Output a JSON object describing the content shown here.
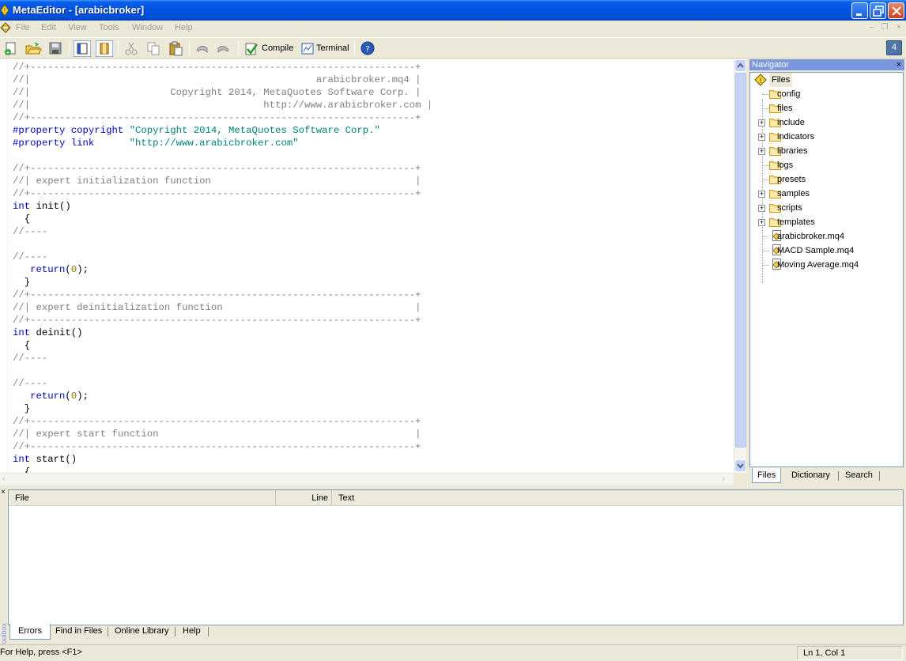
{
  "window": {
    "title": "MetaEditor - [arabicbroker]",
    "icons": {
      "app": "metaeditor-icon",
      "minimize": "minimize-icon",
      "restore": "restore-icon",
      "close": "close-icon"
    }
  },
  "menu": {
    "items": [
      "File",
      "Edit",
      "View",
      "Tools",
      "Window",
      "Help"
    ]
  },
  "toolbar": {
    "compile_label": "Compile",
    "terminal_label": "Terminal",
    "count_badge": "4"
  },
  "editor": {
    "lines": [
      [
        [
          "c-comment",
          "//+------------------------------------------------------------------+"
        ]
      ],
      [
        [
          "c-comment",
          "//|                                                 arabicbroker.mq4 |"
        ]
      ],
      [
        [
          "c-comment",
          "//|                        Copyright 2014, MetaQuotes Software Corp. |"
        ]
      ],
      [
        [
          "c-comment",
          "//|                                        http://www.arabicbroker.com |"
        ]
      ],
      [
        [
          "c-comment",
          "//+------------------------------------------------------------------+"
        ]
      ],
      [
        [
          "c-kw",
          "#property copyright "
        ],
        [
          "c-str",
          "\"Copyright 2014, MetaQuotes Software Corp.\""
        ]
      ],
      [
        [
          "c-kw",
          "#property link      "
        ],
        [
          "c-str",
          "\"http://www.arabicbroker.com\""
        ]
      ],
      [
        [
          "c-plain",
          ""
        ]
      ],
      [
        [
          "c-comment",
          "//+------------------------------------------------------------------+"
        ]
      ],
      [
        [
          "c-comment",
          "//| expert initialization function                                   |"
        ]
      ],
      [
        [
          "c-comment",
          "//+------------------------------------------------------------------+"
        ]
      ],
      [
        [
          "c-kw",
          "int"
        ],
        [
          "c-plain",
          " init()"
        ]
      ],
      [
        [
          "c-plain",
          "  {"
        ]
      ],
      [
        [
          "c-comment",
          "//----"
        ]
      ],
      [
        [
          "c-plain",
          ""
        ]
      ],
      [
        [
          "c-comment",
          "//----"
        ]
      ],
      [
        [
          "c-plain",
          "   "
        ],
        [
          "c-kw",
          "return"
        ],
        [
          "c-plain",
          "("
        ],
        [
          "c-num",
          "0"
        ],
        [
          "c-plain",
          ");"
        ]
      ],
      [
        [
          "c-plain",
          "  }"
        ]
      ],
      [
        [
          "c-comment",
          "//+------------------------------------------------------------------+"
        ]
      ],
      [
        [
          "c-comment",
          "//| expert deinitialization function                                 |"
        ]
      ],
      [
        [
          "c-comment",
          "//+------------------------------------------------------------------+"
        ]
      ],
      [
        [
          "c-kw",
          "int"
        ],
        [
          "c-plain",
          " deinit()"
        ]
      ],
      [
        [
          "c-plain",
          "  {"
        ]
      ],
      [
        [
          "c-comment",
          "//----"
        ]
      ],
      [
        [
          "c-plain",
          ""
        ]
      ],
      [
        [
          "c-comment",
          "//----"
        ]
      ],
      [
        [
          "c-plain",
          "   "
        ],
        [
          "c-kw",
          "return"
        ],
        [
          "c-plain",
          "("
        ],
        [
          "c-num",
          "0"
        ],
        [
          "c-plain",
          ");"
        ]
      ],
      [
        [
          "c-plain",
          "  }"
        ]
      ],
      [
        [
          "c-comment",
          "//+------------------------------------------------------------------+"
        ]
      ],
      [
        [
          "c-comment",
          "//| expert start function                                            |"
        ]
      ],
      [
        [
          "c-comment",
          "//+------------------------------------------------------------------+"
        ]
      ],
      [
        [
          "c-kw",
          "int"
        ],
        [
          "c-plain",
          " start()"
        ]
      ],
      [
        [
          "c-plain",
          "  {"
        ]
      ]
    ]
  },
  "navigator": {
    "title": "Navigator",
    "close": "×",
    "root": "Files",
    "items": [
      {
        "label": "config",
        "type": "folder",
        "expandable": false
      },
      {
        "label": "files",
        "type": "folder",
        "expandable": false
      },
      {
        "label": "include",
        "type": "folder",
        "expandable": true
      },
      {
        "label": "indicators",
        "type": "folder",
        "expandable": true
      },
      {
        "label": "libraries",
        "type": "folder",
        "expandable": true
      },
      {
        "label": "logs",
        "type": "folder",
        "expandable": false
      },
      {
        "label": "presets",
        "type": "folder",
        "expandable": false
      },
      {
        "label": "samples",
        "type": "folder",
        "expandable": true
      },
      {
        "label": "scripts",
        "type": "folder",
        "expandable": true
      },
      {
        "label": "templates",
        "type": "folder",
        "expandable": true
      },
      {
        "label": "arabicbroker.mq4",
        "type": "file",
        "expandable": false
      },
      {
        "label": "MACD Sample.mq4",
        "type": "file",
        "expandable": false
      },
      {
        "label": "Moving Average.mq4",
        "type": "file",
        "expandable": false
      }
    ],
    "tabs": [
      "Files",
      "Dictionary",
      "Search"
    ],
    "active_tab": 0
  },
  "toolbox": {
    "close": "×",
    "side_label": "Toolbox",
    "columns": [
      "File",
      "Line",
      "Text"
    ],
    "tabs": [
      "Errors",
      "Find in Files",
      "Online Library",
      "Help"
    ],
    "active_tab": 0
  },
  "status": {
    "help": "For Help, press <F1>",
    "position": "Ln 1, Col 1"
  },
  "colors": {
    "titlebar": "#0053e2",
    "navigator_header": "#7a96df",
    "keyword": "#0000c8",
    "string": "#008080",
    "comment": "#808080"
  }
}
